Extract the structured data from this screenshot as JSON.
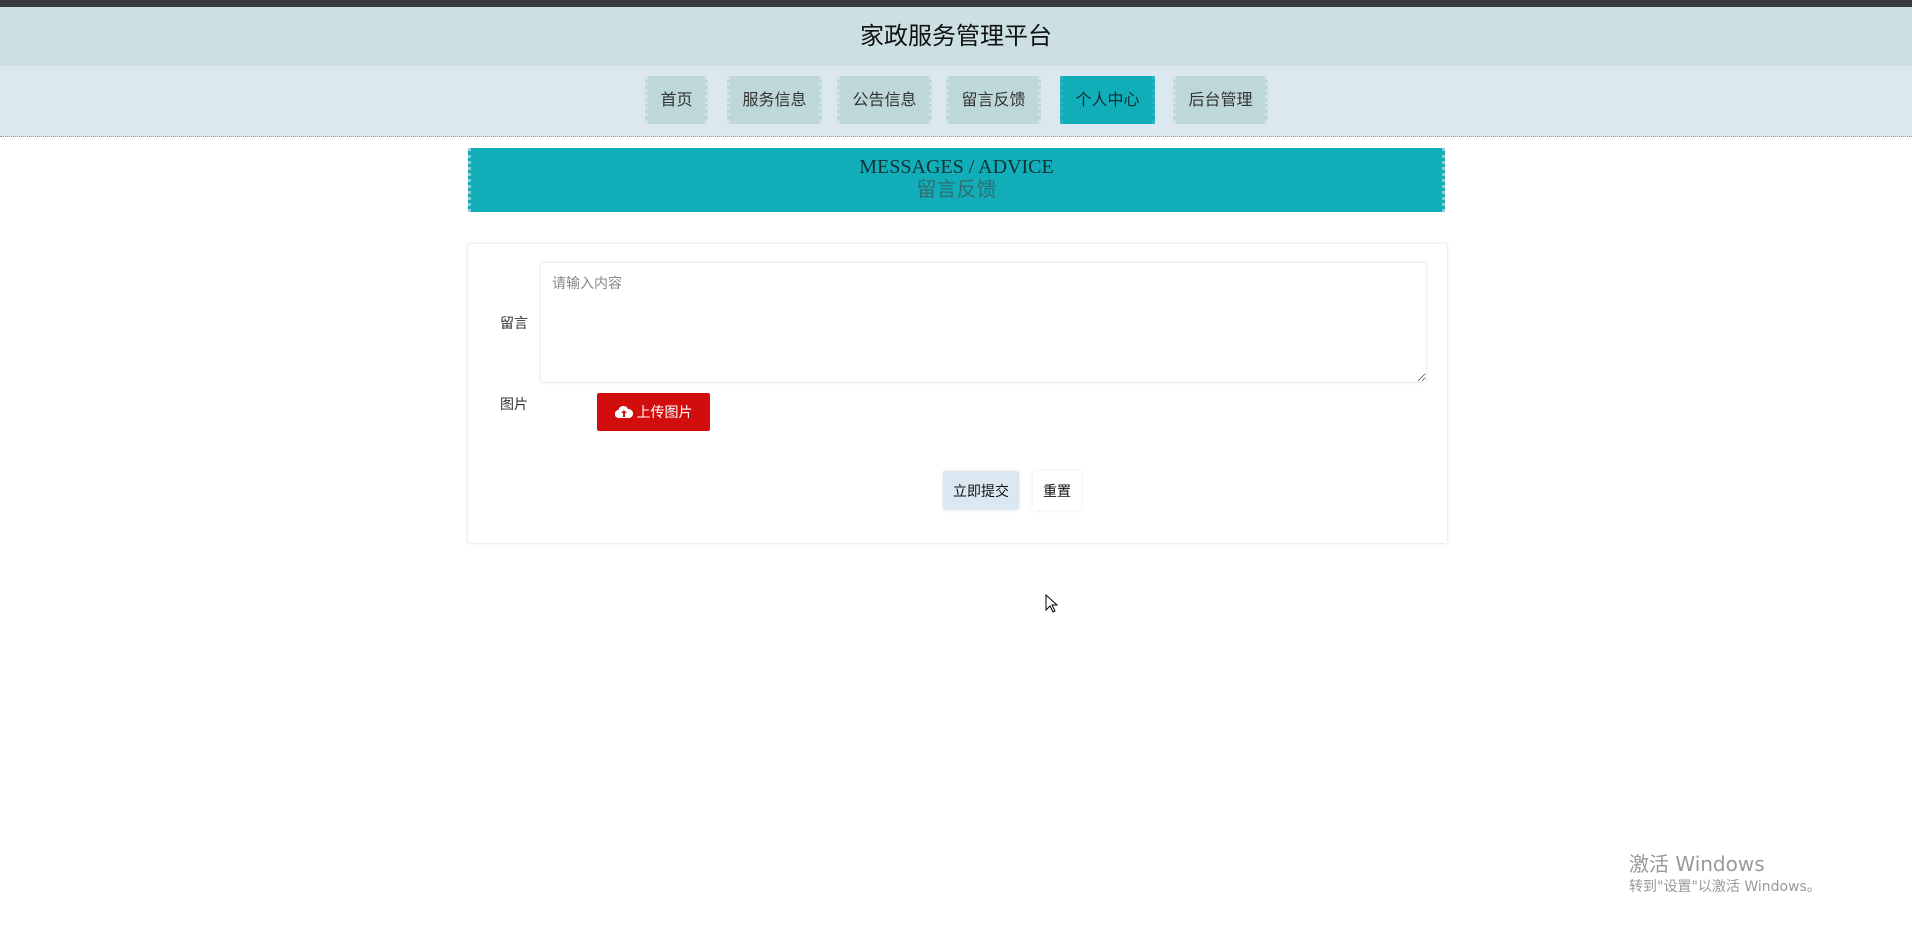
{
  "header": {
    "title": "家政服务管理平台"
  },
  "nav": {
    "items": [
      {
        "label": "首页"
      },
      {
        "label": "服务信息"
      },
      {
        "label": "公告信息"
      },
      {
        "label": "留言反馈"
      },
      {
        "label": "个人中心",
        "active": true
      },
      {
        "label": "后台管理"
      }
    ]
  },
  "banner": {
    "en": "MESSAGES / ADVICE",
    "cn": "留言反馈"
  },
  "form": {
    "message_label": "留言",
    "message_placeholder": "请输入内容",
    "message_value": "",
    "image_label": "图片",
    "upload_label": "上传图片",
    "submit_label": "立即提交",
    "reset_label": "重置"
  },
  "watermark": {
    "line1": "激活 Windows",
    "line2": "转到\"设置\"以激活 Windows。"
  },
  "colors": {
    "accent": "#11adb8",
    "upload": "#d20d0d"
  }
}
